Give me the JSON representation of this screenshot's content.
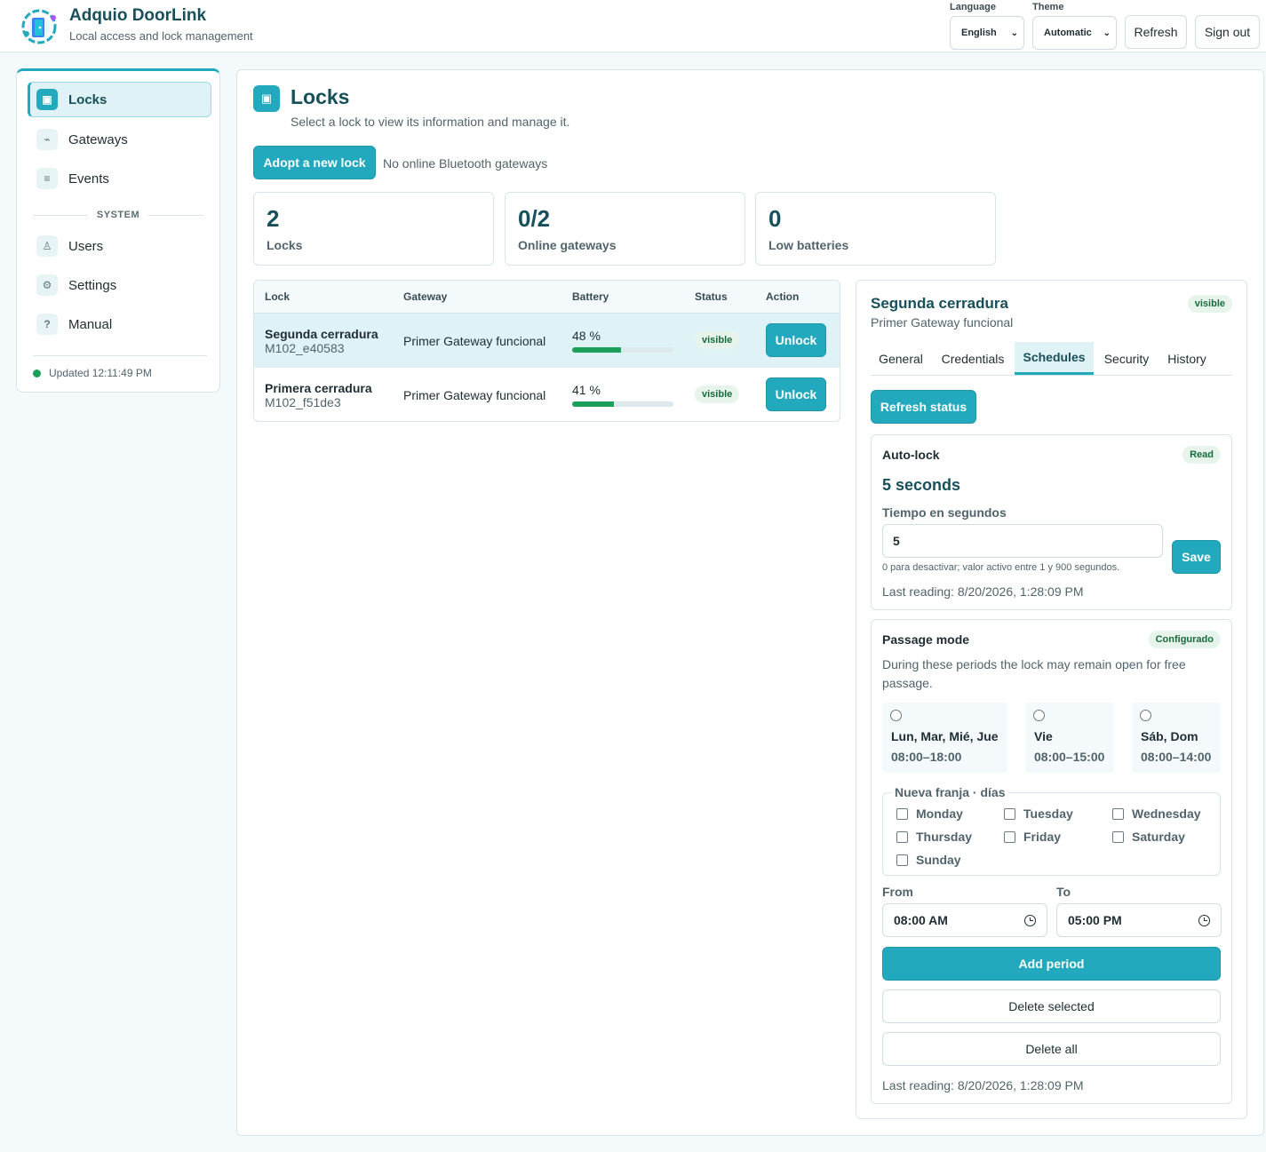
{
  "app": {
    "title": "Adquio DoorLink",
    "subtitle": "Local access and lock management"
  },
  "header": {
    "language_label": "Language",
    "language_value": "English",
    "theme_label": "Theme",
    "theme_value": "Automatic",
    "refresh_label": "Refresh",
    "signout_label": "Sign out"
  },
  "sidebar": {
    "items": [
      {
        "label": "Locks",
        "icon": "▣"
      },
      {
        "label": "Gateways",
        "icon": "⌁"
      },
      {
        "label": "Events",
        "icon": "≡"
      }
    ],
    "section_label": "SYSTEM",
    "system_items": [
      {
        "label": "Users",
        "icon": "♙"
      },
      {
        "label": "Settings",
        "icon": "⚙"
      },
      {
        "label": "Manual",
        "icon": "?"
      }
    ],
    "updated": "Updated 12:11:49 PM"
  },
  "page": {
    "icon": "▣",
    "title": "Locks",
    "subtitle": "Select a lock to view its information and manage it.",
    "adopt_label": "Adopt a new lock",
    "no_gateways": "No online Bluetooth gateways"
  },
  "stats": [
    {
      "value": "2",
      "label": "Locks"
    },
    {
      "value": "0/2",
      "label": "Online gateways"
    },
    {
      "value": "0",
      "label": "Low batteries"
    }
  ],
  "table": {
    "headers": {
      "lock": "Lock",
      "gateway": "Gateway",
      "battery": "Battery",
      "status": "Status",
      "action": "Action"
    },
    "rows": [
      {
        "name": "Segunda cerradura",
        "id": "M102_e40583",
        "gateway": "Primer Gateway funcional",
        "battery": "48 %",
        "battery_pct": 48,
        "status": "visible",
        "action": "Unlock"
      },
      {
        "name": "Primera cerradura",
        "id": "M102_f51de3",
        "gateway": "Primer Gateway funcional",
        "battery": "41 %",
        "battery_pct": 41,
        "status": "visible",
        "action": "Unlock"
      }
    ]
  },
  "details": {
    "title": "Segunda cerradura",
    "subtitle": "Primer Gateway funcional",
    "badge": "visible",
    "tabs": [
      "General",
      "Credentials",
      "Schedules",
      "Security",
      "History"
    ],
    "active_tab": "Schedules",
    "refresh_status_label": "Refresh status",
    "autolock": {
      "title": "Auto-lock",
      "badge": "Read",
      "value": "5 seconds",
      "input_label": "Tiempo en segundos",
      "input_value": "5",
      "save_label": "Save",
      "hint": "0 para desactivar; valor activo entre 1 y 900 segundos.",
      "last_reading": "Last reading: 8/20/2026, 1:28:09 PM"
    },
    "passage": {
      "title": "Passage mode",
      "badge": "Configurado",
      "description": "During these periods the lock may remain open for free passage.",
      "periods": [
        {
          "days": "Lun, Mar, Mié, Jue",
          "hours": "08:00–18:00"
        },
        {
          "days": "Vie",
          "hours": "08:00–15:00"
        },
        {
          "days": "Sáb, Dom",
          "hours": "08:00–14:00"
        }
      ],
      "new_range_legend": "Nueva franja · días",
      "days": [
        "Monday",
        "Tuesday",
        "Wednesday",
        "Thursday",
        "Friday",
        "Saturday",
        "Sunday"
      ],
      "from_label": "From",
      "from_value": "08:00 AM",
      "to_label": "To",
      "to_value": "05:00 PM",
      "add_label": "Add period",
      "delete_selected_label": "Delete selected",
      "delete_all_label": "Delete all",
      "last_reading": "Last reading: 8/20/2026, 1:28:09 PM"
    }
  }
}
